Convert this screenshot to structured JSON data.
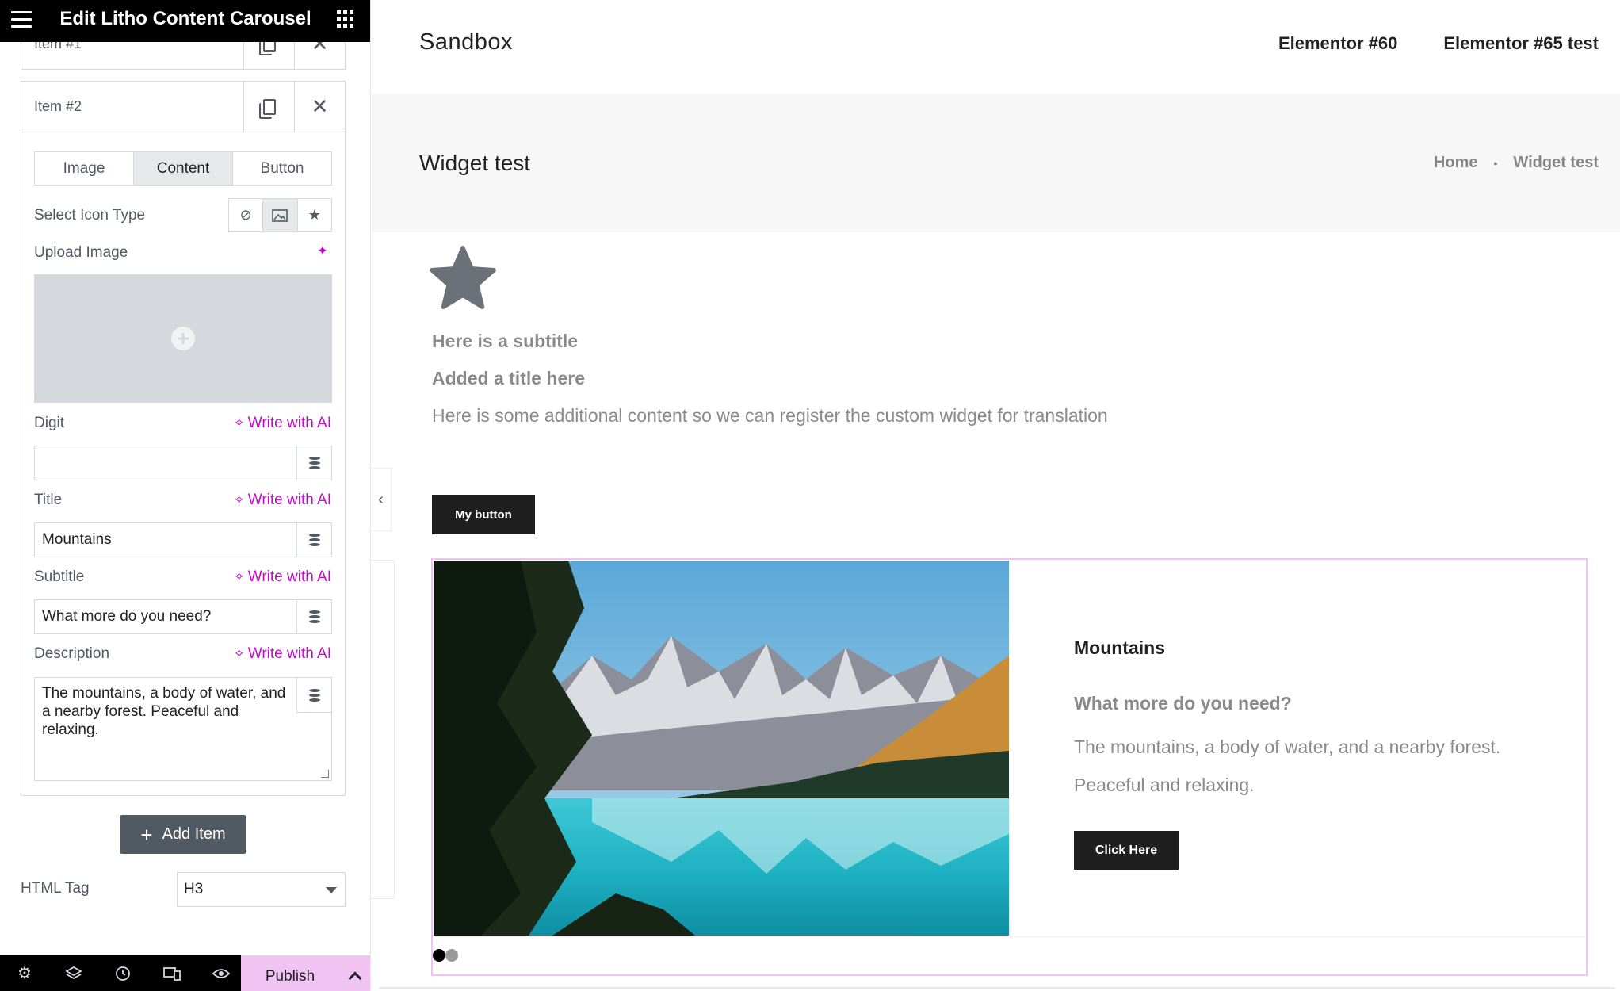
{
  "panel": {
    "title": "Edit Litho Content Carousel",
    "prev_item_label": "Item #1",
    "item_label": "Item #2",
    "tabs": [
      "Image",
      "Content",
      "Button"
    ],
    "select_icon_type_label": "Select Icon Type",
    "upload_image_label": "Upload Image",
    "write_with_ai": "Write with AI",
    "fields": {
      "digit": {
        "label": "Digit",
        "value": ""
      },
      "title": {
        "label": "Title",
        "value": "Mountains"
      },
      "subtitle": {
        "label": "Subtitle",
        "value": "What more do you need?"
      },
      "description": {
        "label": "Description",
        "value": "The mountains, a body of water, and a nearby forest. Peaceful and relaxing."
      }
    },
    "add_item_label": "Add Item",
    "html_tag": {
      "label": "HTML Tag",
      "value": "H3"
    }
  },
  "footer": {
    "publish_label": "Publish"
  },
  "site": {
    "name": "Sandbox",
    "nav": [
      "Elementor #60",
      "Elementor #65 test"
    ],
    "page_title": "Widget test",
    "breadcrumb": [
      "Home",
      "Widget test"
    ]
  },
  "widget": {
    "subtitle": "Here is a subtitle",
    "title": "Added a title here",
    "content": "Here is some additional content so we can register the custom widget for translation",
    "button_label": "My button"
  },
  "carousel": {
    "slide_title": "Mountains",
    "slide_subtitle": "What more do you need?",
    "slide_description": "The mountains, a body of water, and a nearby forest. Peaceful and relaxing.",
    "button_label": "Click Here",
    "slide_count": 2,
    "active_slide": 1
  },
  "colors": {
    "accent": "#c00ec9",
    "publish_bg": "#f0c3f2",
    "header_bg": "#000000",
    "button_bg": "#1f1f1f"
  }
}
